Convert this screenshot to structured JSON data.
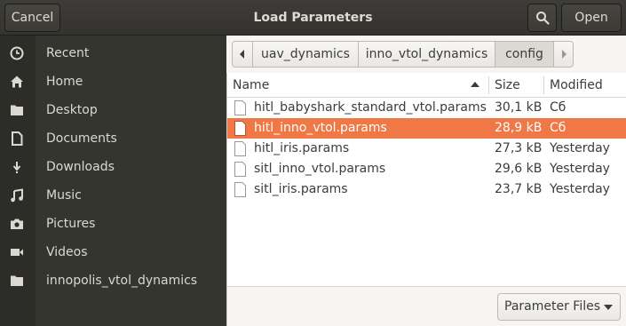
{
  "header": {
    "title": "Load Parameters",
    "cancel_label": "Cancel",
    "open_label": "Open"
  },
  "sidebar": {
    "items": [
      {
        "label": "Recent",
        "icon": "clock-icon"
      },
      {
        "label": "Home",
        "icon": "home-icon"
      },
      {
        "label": "Desktop",
        "icon": "folder-icon"
      },
      {
        "label": "Documents",
        "icon": "document-icon"
      },
      {
        "label": "Downloads",
        "icon": "download-icon"
      },
      {
        "label": "Music",
        "icon": "music-icon"
      },
      {
        "label": "Pictures",
        "icon": "camera-icon"
      },
      {
        "label": "Videos",
        "icon": "video-icon"
      },
      {
        "label": "innopolis_vtol_dynamics",
        "icon": "folder-icon"
      }
    ]
  },
  "pathbar": {
    "segments": [
      "uav_dynamics",
      "inno_vtol_dynamics",
      "config"
    ],
    "active": "config"
  },
  "file_list": {
    "columns": {
      "name": "Name",
      "size": "Size",
      "modified": "Modified"
    },
    "sort": "name-ascending",
    "rows": [
      {
        "name": "hitl_babyshark_standard_vtol.params",
        "size": "30,1 kB",
        "modified": "Сб",
        "selected": false
      },
      {
        "name": "hitl_inno_vtol.params",
        "size": "28,9 kB",
        "modified": "Сб",
        "selected": true
      },
      {
        "name": "hitl_iris.params",
        "size": "27,3 kB",
        "modified": "Yesterday",
        "selected": false
      },
      {
        "name": "sitl_inno_vtol.params",
        "size": "29,6 kB",
        "modified": "Yesterday",
        "selected": false
      },
      {
        "name": "sitl_iris.params",
        "size": "23,7 kB",
        "modified": "Yesterday",
        "selected": false
      }
    ]
  },
  "filter": {
    "selected": "Parameter Files"
  },
  "colors": {
    "accent": "#f07746",
    "header_bg": "#3d3c38",
    "sidebar_bg": "#35352f"
  }
}
